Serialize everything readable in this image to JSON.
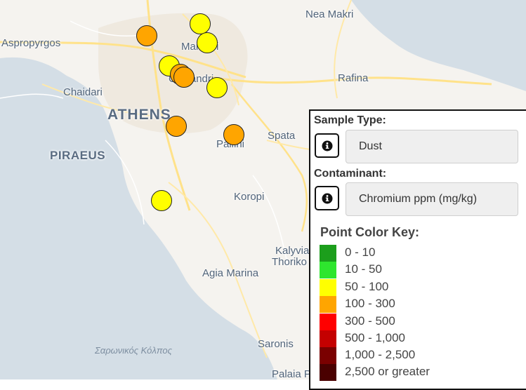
{
  "map": {
    "places": [
      {
        "id": "nea-makri",
        "label": "Nea Makri",
        "kind": "town"
      },
      {
        "id": "aspropyrgos",
        "label": "Aspropyrgos",
        "kind": "town"
      },
      {
        "id": "marousi",
        "label": "Marousi",
        "kind": "town"
      },
      {
        "id": "chalandri",
        "label": "Chalandri",
        "kind": "town"
      },
      {
        "id": "chaidari",
        "label": "Chaidari",
        "kind": "town"
      },
      {
        "id": "rafina",
        "label": "Rafina",
        "kind": "town"
      },
      {
        "id": "athens",
        "label": "ATHENS",
        "kind": "city"
      },
      {
        "id": "spata",
        "label": "Spata",
        "kind": "town"
      },
      {
        "id": "pallini",
        "label": "Pallini",
        "kind": "town"
      },
      {
        "id": "piraeus",
        "label": "PIRAEUS",
        "kind": "city"
      },
      {
        "id": "koropi",
        "label": "Koropi",
        "kind": "town"
      },
      {
        "id": "kalyvia",
        "label": "Kalyvia",
        "kind": "town"
      },
      {
        "id": "thoriko",
        "label": "Thoriko",
        "kind": "town"
      },
      {
        "id": "agia-marina",
        "label": "Agia Marina",
        "kind": "town"
      },
      {
        "id": "saronikos",
        "label": "Σαρωνικός Κόλπος",
        "kind": "sea"
      },
      {
        "id": "saronis",
        "label": "Saronis",
        "kind": "town"
      },
      {
        "id": "palaia",
        "label": "Palaia Pho",
        "kind": "town"
      }
    ],
    "markers": [
      {
        "id": "m1",
        "range": "100 - 300",
        "color": "#ffa500"
      },
      {
        "id": "m2",
        "range": "50 - 100",
        "color": "#ffff00"
      },
      {
        "id": "m3",
        "range": "50 - 100",
        "color": "#ffff00"
      },
      {
        "id": "m4",
        "range": "50 - 100",
        "color": "#ffff00"
      },
      {
        "id": "m5",
        "range": "100 - 300",
        "color": "#ffa500"
      },
      {
        "id": "m6",
        "range": "100 - 300",
        "color": "#ffa500"
      },
      {
        "id": "m7",
        "range": "50 - 100",
        "color": "#ffff00"
      },
      {
        "id": "m8",
        "range": "100 - 300",
        "color": "#ffa500"
      },
      {
        "id": "m9",
        "range": "100 - 300",
        "color": "#ffa500"
      },
      {
        "id": "m10",
        "range": "50 - 100",
        "color": "#ffff00"
      }
    ]
  },
  "panel": {
    "sample_type_label": "Sample Type:",
    "sample_type_value": "Dust",
    "contaminant_label": "Contaminant:",
    "contaminant_value": "Chromium ppm (mg/kg)",
    "info_icon": "info-circle-icon",
    "key_title": "Point Color Key:",
    "key": [
      {
        "label": "0 - 10",
        "color": "#1c9e1c"
      },
      {
        "label": "10 - 50",
        "color": "#2ee62e"
      },
      {
        "label": "50 - 100",
        "color": "#ffff00"
      },
      {
        "label": "100 - 300",
        "color": "#ffa500"
      },
      {
        "label": "300 - 500",
        "color": "#ff0000"
      },
      {
        "label": "500 - 1,000",
        "color": "#c40000"
      },
      {
        "label": "1,000 - 2,500",
        "color": "#7a0000"
      },
      {
        "label": "2,500 or greater",
        "color": "#4a0000"
      }
    ]
  }
}
